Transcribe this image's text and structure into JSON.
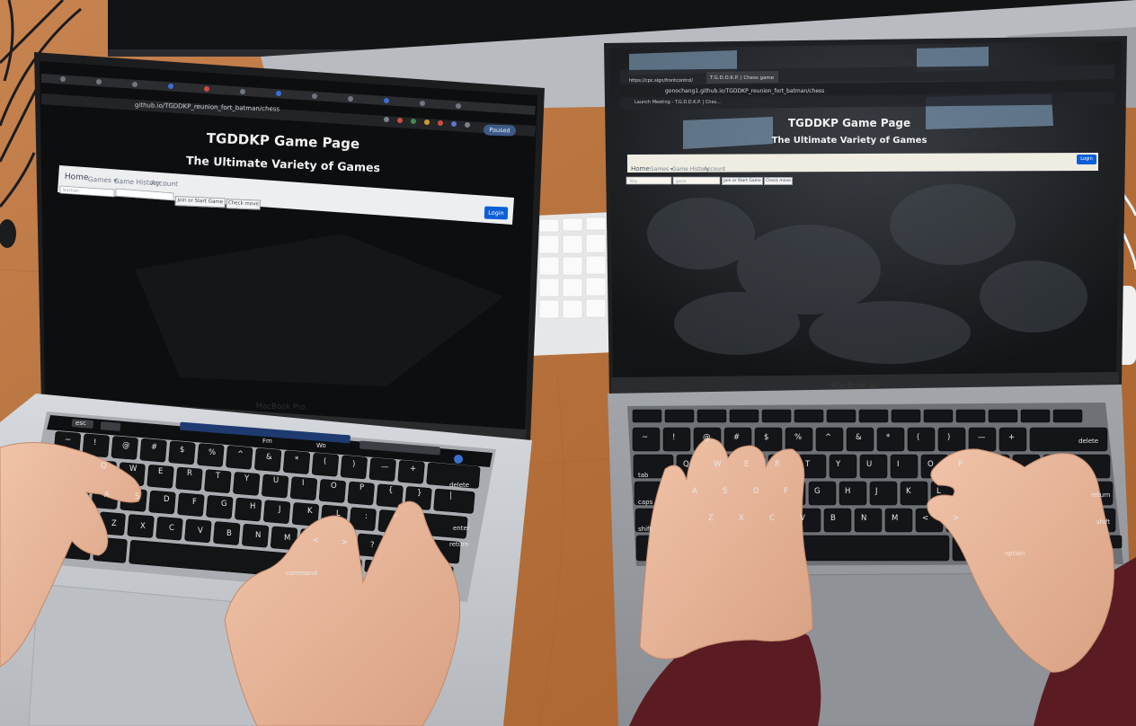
{
  "left_laptop": {
    "browser": {
      "url": "github.io/TGDDKP_reunion_fort_batman/chess",
      "paused_badge": "Paused"
    },
    "page": {
      "title": "TGDDKP Game Page",
      "subtitle": "The Ultimate Variety of Games",
      "nav": {
        "home": "Home",
        "games": "Games ▾",
        "game_history": "Game History",
        "account": "Account"
      },
      "login_button": "Login",
      "name_input_value": "Nathan",
      "code_input_value": "",
      "join_button": "Join or Start Game",
      "check_button": "Check move"
    },
    "model_label": "MacBook Pro",
    "touch_bar": [
      "esc",
      "Fm",
      "Wo"
    ],
    "keys_row1": [
      "~",
      "!",
      "@",
      "#",
      "$",
      "%",
      "^",
      "&",
      "*",
      "(",
      ")",
      "—",
      "+",
      "delete"
    ],
    "keys_row2": [
      "Q",
      "W",
      "E",
      "R",
      "T",
      "Y",
      "U",
      "I",
      "O",
      "P",
      "{",
      "}",
      "|"
    ],
    "keys_row3": [
      "A",
      "S",
      "D",
      "F",
      "G",
      "H",
      "J",
      "K",
      "L",
      ":",
      "\"",
      "enter"
    ],
    "keys_row4": [
      "Z",
      "X",
      "C",
      "V",
      "B",
      "N",
      "M",
      "<",
      ">",
      "?",
      "return"
    ],
    "keys_row5": [
      "command"
    ]
  },
  "right_laptop": {
    "browser": {
      "tab_first": "https://cpc.sign/frontcontrol/",
      "tab_active": "T.G.D.D.K.P. | Chess game",
      "url": "gonochang1.github.io/TGDDKP_reunion_fort_batman/chess",
      "bookmarks": "Launch Meeting -    T.G.D.D.K.P. | Ches..."
    },
    "page": {
      "title": "TGDDKP Game Page",
      "subtitle": "The Ultimate Variety of Games",
      "nav": {
        "home": "Home",
        "games": "Games ▾",
        "game_history": "Game History",
        "account": "Account"
      },
      "login_button": "Login",
      "name_input_value": "Toby",
      "code_input_value": "game",
      "join_button": "Join or Start Game",
      "check_button": "Check move"
    },
    "model_label": "MacBook Air",
    "keys_row1": [
      "~",
      "!",
      "@",
      "#",
      "$",
      "%",
      "^",
      "&",
      "*",
      "(",
      ")",
      "—",
      "+",
      "delete"
    ],
    "keys_row2": [
      "tab",
      "Q",
      "W",
      "E",
      "R",
      "T",
      "Y",
      "U",
      "I",
      "O",
      "P"
    ],
    "keys_row3": [
      "caps",
      "A",
      "S",
      "D",
      "F",
      "G",
      "H",
      "J",
      "K",
      "L",
      "return"
    ],
    "keys_row4": [
      "shift",
      "Z",
      "X",
      "C",
      "V",
      "B",
      "N",
      "M",
      "<",
      ">",
      "shift"
    ],
    "keys_row5": [
      "option"
    ]
  },
  "colors": {
    "desk": "#b9773f",
    "screen_dark": "#0d0e10",
    "navbar_bg": "#eceef0",
    "login_button": "#0b5ed7",
    "laptop_silver": "#c9ccd0",
    "laptop_spacegray": "#8e9196",
    "skin": "#e9b79c",
    "sleeve": "#5a1c22"
  }
}
